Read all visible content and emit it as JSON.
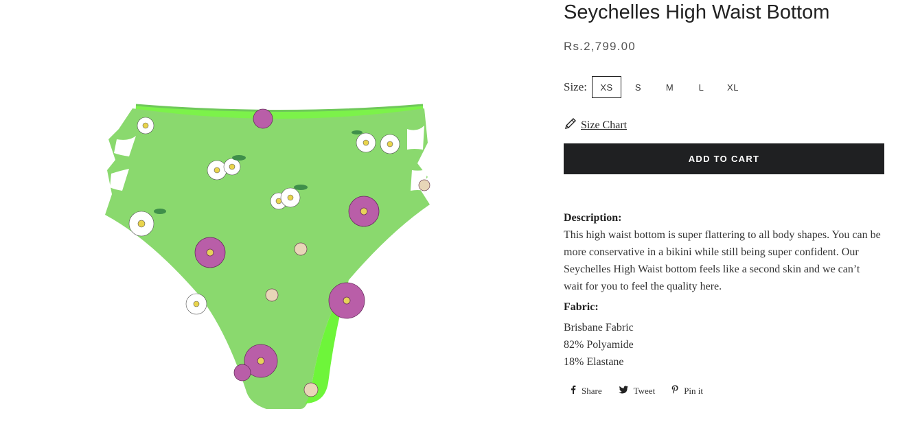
{
  "product": {
    "title": "Seychelles High Waist Bottom",
    "price": "Rs.2,799.00",
    "image_icon": "floral-green-high-waist-bikini-bottom"
  },
  "size": {
    "label": "Size:",
    "options": [
      "XS",
      "S",
      "M",
      "L",
      "XL"
    ],
    "selected": "XS"
  },
  "size_chart": {
    "label": "Size Chart",
    "icon": "ruler-pencil-icon"
  },
  "cart": {
    "button_label": "ADD TO CART"
  },
  "description": {
    "heading": "Description:",
    "text": "This high waist bottom is super flattering to all body shapes. You can be more conservative in a bikini while still being super confident. Our Seychelles High Waist bottom feels like a second skin and we can’t wait for you to feel the quality here.",
    "fabric_heading": "Fabric:",
    "fabric_lines": [
      "Brisbane Fabric",
      "82% Polyamide",
      "18% Elastane"
    ]
  },
  "share": {
    "facebook_label": "Share",
    "twitter_label": "Tweet",
    "pinterest_label": "Pin it"
  },
  "colors": {
    "button_bg": "#1f2022",
    "fabric_green": "#8ad96e",
    "flower_pink": "#b95ea8"
  }
}
